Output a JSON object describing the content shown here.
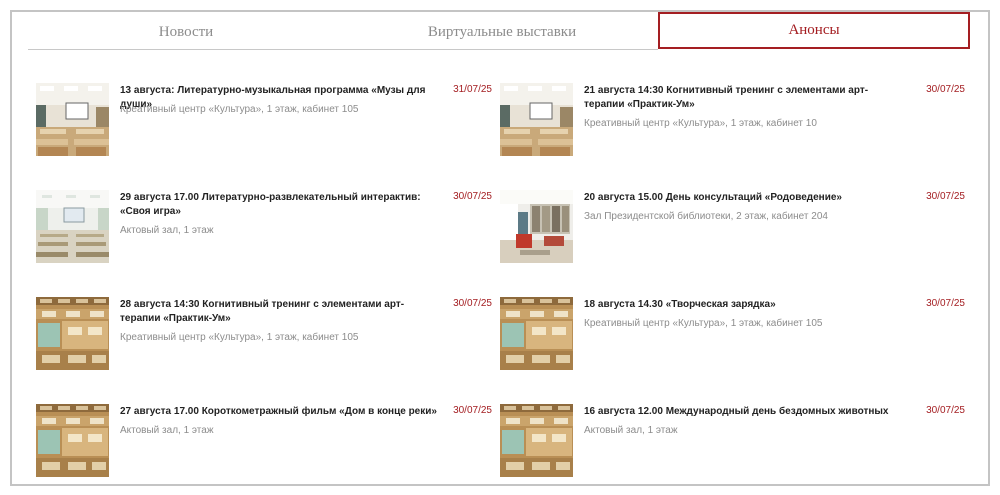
{
  "tabs": [
    {
      "label": "Новости",
      "active": false
    },
    {
      "label": "Виртуальные выставки",
      "active": false
    },
    {
      "label": "Анонсы",
      "active": true
    }
  ],
  "colors": {
    "accent": "#a41e22",
    "muted": "#8c8c8c",
    "border": "#c4c4c4"
  },
  "announcements": [
    {
      "title": "13 августа: Литературно-музыкальная программа «Музы для души»",
      "place": "Креативный центр «Культура», 1 этаж, кабинет 105",
      "date": "31/07/25",
      "image": "classroom-photo"
    },
    {
      "title": "21 августа 14:30  Когнитивный тренинг с элементами арт-терапии «Практик-Ум»",
      "place": "Креативный центр «Культура», 1 этаж, кабинет 10",
      "date": "30/07/25",
      "image": "classroom-photo"
    },
    {
      "title": "29 августа 17.00  Литературно-развлекательный интерактив: «Своя игра»",
      "place": "Актовый зал, 1 этаж",
      "date": "30/07/25",
      "image": "assembly-hall-photo"
    },
    {
      "title": "20 августа  15.00 День консультаций «Родоведение»",
      "place": "Зал Президентской библиотеки, 2 этаж, кабинет 204",
      "date": "30/07/25",
      "image": "library-hall-photo"
    },
    {
      "title": "28 августа 14:30  Когнитивный тренинг с элементами арт-терапии «Практик-Ум»",
      "place": "Креативный центр «Культура», 1 этаж, кабинет 105",
      "date": "30/07/25",
      "image": "card-catalog-photo"
    },
    {
      "title": "18 августа 14.30 «Творческая зарядка»",
      "place": "Креативный центр «Культура», 1 этаж, кабинет 105",
      "date": "30/07/25",
      "image": "card-catalog-photo"
    },
    {
      "title": "27 августа 17.00  Короткометражный фильм «Дом в конце реки»",
      "place": "Актовый зал, 1 этаж",
      "date": "30/07/25",
      "image": "card-catalog-photo"
    },
    {
      "title": "16 августа 12.00  Международный день бездомных животных",
      "place": "Актовый зал, 1 этаж",
      "date": "30/07/25",
      "image": "card-catalog-photo"
    }
  ]
}
